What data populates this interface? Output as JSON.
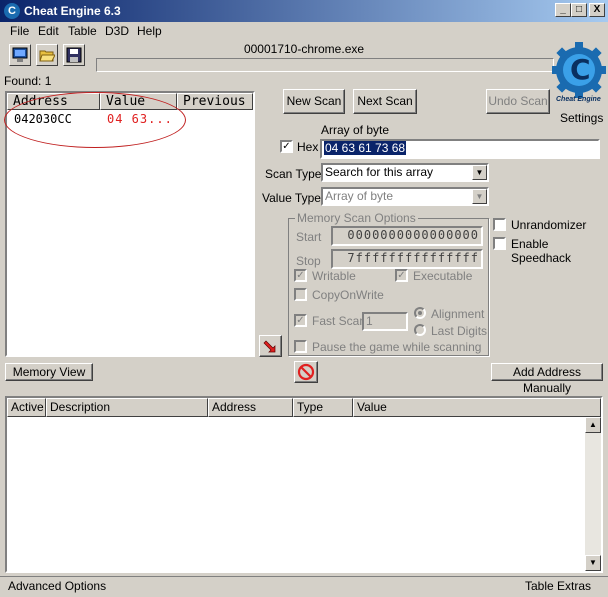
{
  "window": {
    "title": "Cheat Engine 6.3",
    "minimize": "_",
    "maximize": "□",
    "close": "X"
  },
  "menu": [
    "File",
    "Edit",
    "Table",
    "D3D",
    "Help"
  ],
  "process": {
    "name": "00001710-chrome.exe"
  },
  "found_label": "Found: 1",
  "logo": {
    "text": "Cheat Engine"
  },
  "settings_label": "Settings",
  "results": {
    "columns": [
      "Address",
      "Value",
      "Previous"
    ],
    "rows": [
      {
        "address": "042030CC",
        "value": "04 63...",
        "previous": ""
      }
    ]
  },
  "buttons": {
    "new_scan": "New Scan",
    "next_scan": "Next Scan",
    "undo_scan": "Undo Scan",
    "memory_view": "Memory View",
    "add_address": "Add Address Manually"
  },
  "scan": {
    "value_label": "Array of byte",
    "hex_label": "Hex",
    "hex_checked": true,
    "value": "04 63 61 73 68",
    "scan_type_label": "Scan Type",
    "scan_type": "Search for this array",
    "value_type_label": "Value Type",
    "value_type": "Array of byte"
  },
  "memory_scan_options": {
    "legend": "Memory Scan Options",
    "start_label": "Start",
    "start": "0000000000000000",
    "stop_label": "Stop",
    "stop": "7fffffffffffffff",
    "writable": "Writable",
    "executable": "Executable",
    "copy_on_write": "CopyOnWrite",
    "fast_scan": "Fast Scan",
    "fast_scan_value": "1",
    "alignment": "Alignment",
    "last_digits": "Last Digits",
    "pause": "Pause the game while scanning"
  },
  "unrandomizer": "Unrandomizer",
  "enable_speedhack": "Enable Speedhack",
  "address_table": {
    "columns": [
      "Active",
      "Description",
      "Address",
      "Type",
      "Value"
    ]
  },
  "status": {
    "advanced_options": "Advanced Options",
    "table_extras": "Table Extras"
  },
  "colors": {
    "title_gradient_start": "#0a246a",
    "title_gradient_end": "#a6caf0",
    "selected_value_bg": "#0a246a",
    "result_value": "#e02020",
    "annotation_circle": "#c02020"
  }
}
